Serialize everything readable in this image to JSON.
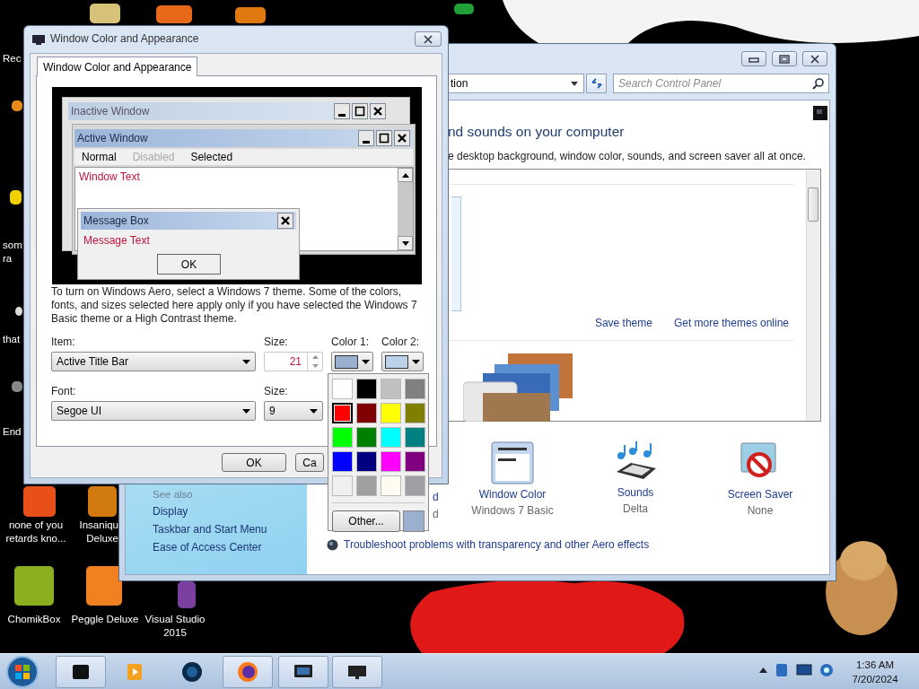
{
  "desktop_icons": [
    {
      "lines": [
        "Rec"
      ]
    },
    {
      "lines": [
        "som",
        "ra"
      ]
    },
    {
      "lines": [
        "that"
      ]
    },
    {
      "lines": [
        "End"
      ]
    },
    {
      "lines": [
        "none of you",
        "retards kno..."
      ]
    },
    {
      "lines": [
        "Insaniqu",
        "Deluxe"
      ]
    },
    {
      "lines": [
        "ChomikBox"
      ]
    },
    {
      "lines": [
        "Peggle Deluxe"
      ]
    },
    {
      "lines": [
        "Visual Studio",
        "2015"
      ]
    }
  ],
  "control_panel": {
    "address": "tion",
    "search": {
      "placeholder": "Search Control Panel"
    },
    "heading": "nd sounds on your computer",
    "subtitle": "e desktop background, window color, sounds, and screen saver all at once.",
    "links": [
      "Save theme",
      "Get more themes online"
    ],
    "see_also": {
      "title": "See also",
      "links": [
        "Display",
        "Taskbar and Start Menu",
        "Ease of Access Center"
      ]
    },
    "settings": [
      {
        "kind": "partial",
        "label": "d",
        "value": "d"
      },
      {
        "kind": "window_color",
        "label": "Window Color",
        "value": "Windows 7 Basic"
      },
      {
        "kind": "sounds",
        "label": "Sounds",
        "value": "Delta"
      },
      {
        "kind": "screen_saver",
        "label": "Screen Saver",
        "value": "None"
      }
    ],
    "troubleshoot": "Troubleshoot problems with transparency and other Aero effects"
  },
  "dialog": {
    "title": "Window Color and Appearance",
    "tabs": [
      {
        "label": "Window Color and Appearance",
        "selected": true
      }
    ],
    "preview": {
      "inactive_title": "Inactive Window",
      "active_title": "Active Window",
      "menu": [
        {
          "label": "Normal",
          "disabled": false
        },
        {
          "label": "Disabled",
          "disabled": true
        },
        {
          "label": "Selected",
          "disabled": false
        }
      ],
      "window_text": "Window Text",
      "message_title": "Message Box",
      "message_text": "Message Text",
      "message_button": "OK"
    },
    "description": "To turn on Windows Aero, select a Windows 7 theme.  Some of the colors, fonts, and sizes selected here apply only if you have selected the Windows 7 Basic theme or a High Contrast theme.",
    "item": {
      "label": "Item:",
      "value": "Active Title Bar"
    },
    "item_size": {
      "label": "Size:",
      "value": "21"
    },
    "color1": {
      "label": "Color 1:",
      "color": "#9bb0cf"
    },
    "color2": {
      "label": "Color 2:",
      "color": "#bcd2ea"
    },
    "font": {
      "label": "Font:",
      "value": "Segoe UI"
    },
    "font_size": {
      "label": "Size:",
      "value": "9"
    },
    "buttons": [
      "OK",
      "Ca"
    ]
  },
  "color_palette": {
    "swatches": [
      {
        "color": "#ffffff",
        "selected": false
      },
      {
        "color": "#000000",
        "selected": false
      },
      {
        "color": "#c0c0c0",
        "selected": false
      },
      {
        "color": "#808080",
        "selected": false
      },
      {
        "color": "#ff0000",
        "selected": true
      },
      {
        "color": "#800000",
        "selected": false
      },
      {
        "color": "#ffff00",
        "selected": false
      },
      {
        "color": "#808000",
        "selected": false
      },
      {
        "color": "#00ff00",
        "selected": false
      },
      {
        "color": "#008000",
        "selected": false
      },
      {
        "color": "#00ffff",
        "selected": false
      },
      {
        "color": "#008080",
        "selected": false
      },
      {
        "color": "#0000ff",
        "selected": false
      },
      {
        "color": "#000080",
        "selected": false
      },
      {
        "color": "#ff00ff",
        "selected": false
      },
      {
        "color": "#800080",
        "selected": false
      },
      {
        "color": "#f0f0f0",
        "selected": false
      },
      {
        "color": "#a0a0a0",
        "selected": false
      },
      {
        "color": "#fffbf0",
        "selected": false
      },
      {
        "color": "#a0a0a4",
        "selected": false
      }
    ],
    "other_button": "Other...",
    "preview": {
      "color": "#9bb0cf"
    }
  },
  "taskbar": {
    "apps": [
      {
        "running": true
      },
      {
        "running": false
      },
      {
        "running": false
      },
      {
        "running": true
      },
      {
        "running": true
      },
      {
        "running": true
      }
    ],
    "time": "1:36 AM",
    "date": "7/20/2024"
  }
}
